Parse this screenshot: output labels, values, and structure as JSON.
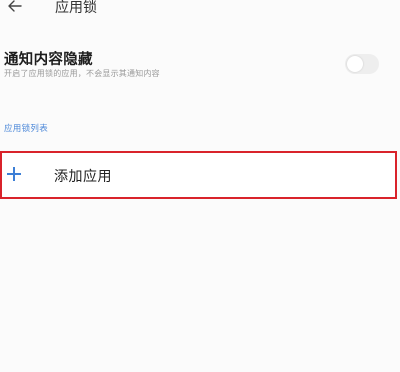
{
  "header": {
    "title": "应用锁",
    "back_icon": "arrow-left-icon"
  },
  "notification_setting": {
    "title": "通知内容隐藏",
    "description": "开启了应用锁的应用，不会显示其通知内容",
    "toggle_on": false
  },
  "app_list": {
    "section_label": "应用锁列表",
    "add_label": "添加应用",
    "add_icon": "plus-icon",
    "accent_color": "#3d7fd6",
    "highlight_color": "#d9232b"
  }
}
